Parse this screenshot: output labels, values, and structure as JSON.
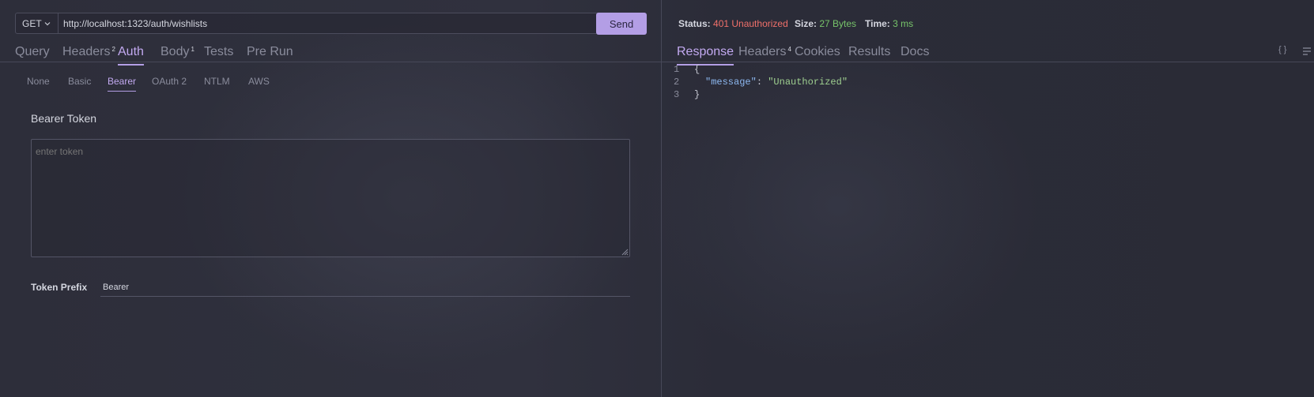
{
  "request": {
    "method": "GET",
    "url": "http://localhost:1323/auth/wishlists",
    "send_label": "Send"
  },
  "request_tabs": [
    {
      "label": "Query",
      "badge": ""
    },
    {
      "label": "Headers",
      "badge": "2"
    },
    {
      "label": "Auth",
      "badge": ""
    },
    {
      "label": "Body",
      "badge": "1"
    },
    {
      "label": "Tests",
      "badge": ""
    },
    {
      "label": "Pre Run",
      "badge": ""
    }
  ],
  "active_request_tab": "Auth",
  "auth_types": [
    "None",
    "Basic",
    "Bearer",
    "OAuth 2",
    "NTLM",
    "AWS"
  ],
  "active_auth_type": "Bearer",
  "bearer": {
    "title": "Bearer Token",
    "token_placeholder": "enter token",
    "prefix_label": "Token Prefix",
    "prefix_value": "Bearer"
  },
  "response_status": {
    "status_label": "Status:",
    "status_value": "401 Unauthorized",
    "size_label": "Size:",
    "size_value": "27 Bytes",
    "time_label": "Time:",
    "time_value": "3 ms"
  },
  "response_tabs": [
    {
      "label": "Response",
      "badge": ""
    },
    {
      "label": "Headers",
      "badge": "4"
    },
    {
      "label": "Cookies",
      "badge": ""
    },
    {
      "label": "Results",
      "badge": ""
    },
    {
      "label": "Docs",
      "badge": ""
    }
  ],
  "active_response_tab": "Response",
  "response_body": {
    "line_numbers": [
      "1",
      "2",
      "3"
    ],
    "open_brace": "{",
    "key": "\"message\"",
    "colon": ": ",
    "value": "\"Unauthorized\"",
    "close_brace": "}"
  },
  "icons": {
    "format": "braces-icon",
    "menu": "wrap-lines-icon"
  },
  "colors": {
    "accent": "#b39ee5",
    "error": "#f0706a",
    "success": "#77c46a",
    "json_key": "#8db8f0",
    "json_string": "#9fd090"
  }
}
